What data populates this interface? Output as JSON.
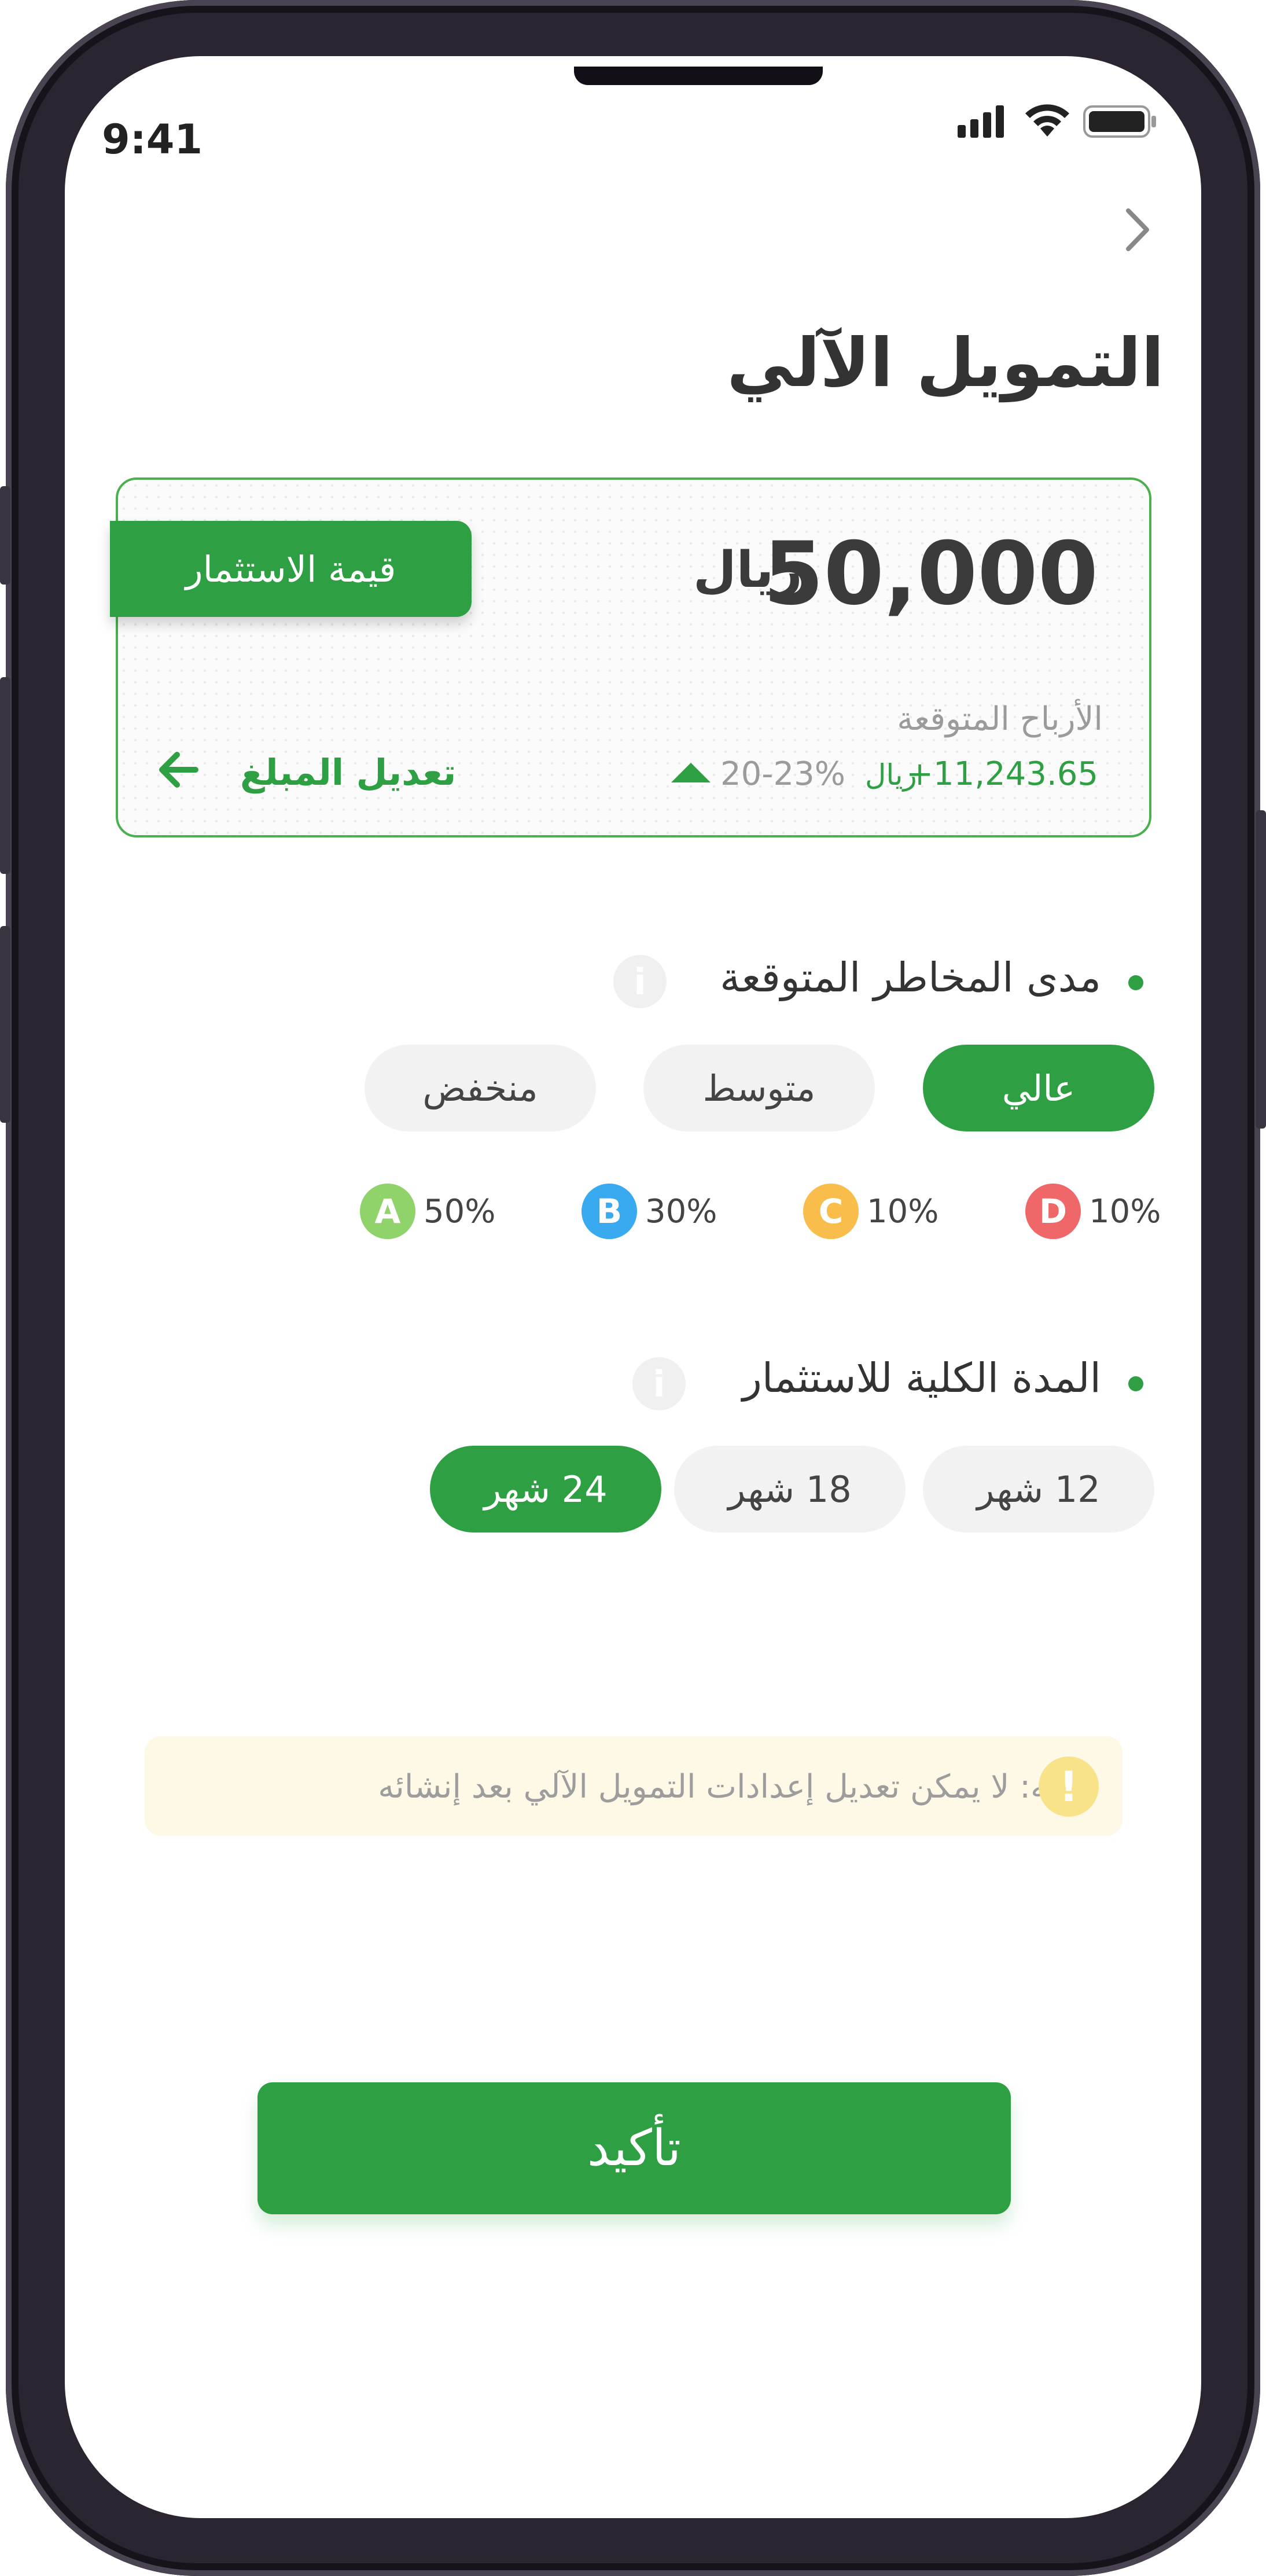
{
  "status_bar": {
    "time": "9:41",
    "icons": [
      "signal-icon",
      "wifi-icon",
      "battery-icon"
    ]
  },
  "header": {
    "back_icon": "chevron-right-icon",
    "title": "التمويل الآلي"
  },
  "investment_card": {
    "tag_label": "قيمة الاستثمار",
    "amount": "50,000",
    "currency": "ريال",
    "expected_profit_label": "الأرباح المتوقعة",
    "expected_profit_value": "+11,243.65",
    "expected_profit_currency": "ريال",
    "expected_profit_percent": "20-23%",
    "edit_link_label": "تعديل المبلغ",
    "edit_icon": "arrow-left-icon"
  },
  "risk_section": {
    "title": "مدى المخاطر المتوقعة",
    "info_icon": "info-icon",
    "options": [
      "عالي",
      "متوسط",
      "منخفض"
    ],
    "selected": "عالي",
    "grades": [
      {
        "letter": "D",
        "percent": "10%",
        "color": "#f0676a"
      },
      {
        "letter": "C",
        "percent": "10%",
        "color": "#f8bd4b"
      },
      {
        "letter": "B",
        "percent": "30%",
        "color": "#3aaaf0"
      },
      {
        "letter": "A",
        "percent": "50%",
        "color": "#8fd36a"
      }
    ]
  },
  "duration_section": {
    "title": "المدة الكلية للاستثمار",
    "info_icon": "info-icon",
    "options": [
      "12 شهر",
      "18 شهر",
      "24 شهر"
    ],
    "selected": "24 شهر"
  },
  "notice": {
    "icon": "exclamation-icon",
    "text": "تنويه: لا يمكن تعديل إعدادات التمويل الآلي بعد إنشائه"
  },
  "confirm_button": {
    "label": "تأكيد"
  },
  "colors": {
    "accent": "#2ea043",
    "card_border": "#4caf50",
    "notice_bg": "#fdf9e6",
    "notice_icon": "#f8e38a"
  }
}
